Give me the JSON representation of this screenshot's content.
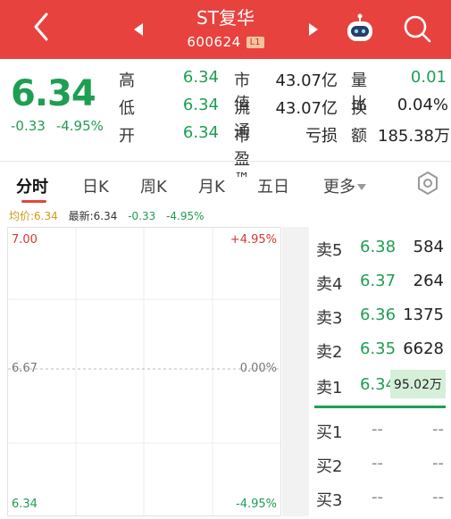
{
  "header": {
    "title": "ST复华",
    "code": "600624",
    "level": "L1",
    "bg_color": "#e8423f"
  },
  "quote": {
    "price": "6.34",
    "change": "-0.33",
    "change_pct": "-4.95%",
    "rows": [
      {
        "l1": "高",
        "v1": "6.34",
        "l2": "市值",
        "v2": "43.07亿",
        "l3": "量比",
        "v3": "0.01"
      },
      {
        "l1": "低",
        "v1": "6.34",
        "l2": "流通",
        "v2": "43.07亿",
        "l3": "换",
        "v3": "0.04%"
      },
      {
        "l1": "开",
        "v1": "6.34",
        "l2": "市盈™",
        "v2": "亏损",
        "l3": "额",
        "v3": "185.38万"
      }
    ]
  },
  "tabs": {
    "items": [
      "分时",
      "日K",
      "周K",
      "月K",
      "五日",
      "更多"
    ],
    "active": "分时"
  },
  "info": {
    "avg": "均价:6.34",
    "latest": "最新:6.34",
    "change": "-0.33",
    "change_pct": "-4.95%"
  },
  "chart": {
    "top_left": "7.00",
    "top_right": "+4.95%",
    "mid_left": "6.67",
    "mid_right": "0.00%",
    "bottom_left": "6.34",
    "bottom_right": "-4.95%"
  },
  "order_book": {
    "asks": [
      {
        "label": "卖5",
        "price": "6.38",
        "vol": "584"
      },
      {
        "label": "卖4",
        "price": "6.37",
        "vol": "264"
      },
      {
        "label": "卖3",
        "price": "6.36",
        "vol": "1375"
      },
      {
        "label": "卖2",
        "price": "6.35",
        "vol": "6628"
      },
      {
        "label": "卖1",
        "price": "6.34",
        "vol": "95.02万"
      }
    ],
    "bids": [
      {
        "label": "买1",
        "price": "--",
        "vol": "--"
      },
      {
        "label": "买2",
        "price": "--",
        "vol": "--"
      },
      {
        "label": "买3",
        "price": "--",
        "vol": "--"
      }
    ]
  },
  "icons": [
    "back-icon",
    "prev-stock-icon",
    "next-stock-icon",
    "robot-assistant-icon",
    "search-icon",
    "settings-hex-icon",
    "dropdown-caret-icon"
  ]
}
